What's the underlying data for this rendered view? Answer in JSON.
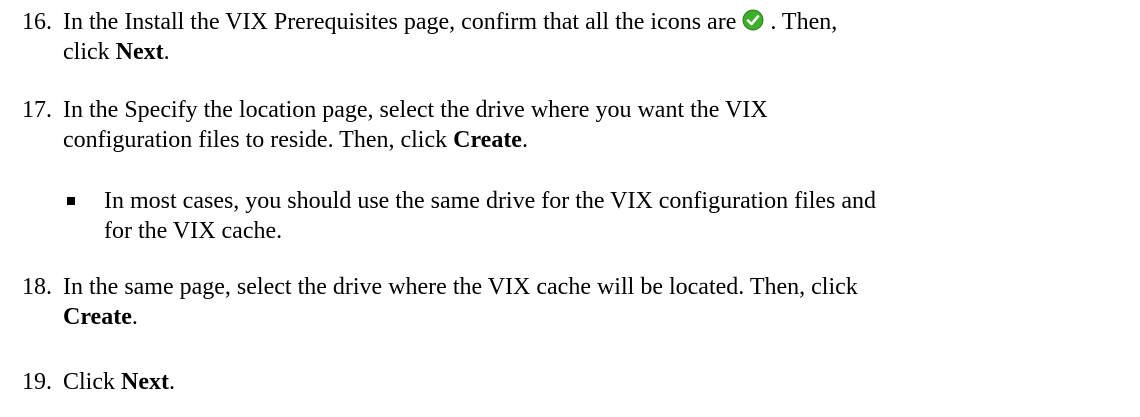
{
  "steps": [
    {
      "number": "16.",
      "lines": [
        {
          "before": "In the Install the VIX Prerequisites page, confirm that all the icons are ",
          "icon": "green-checkmark-icon",
          "after": " . Then,"
        },
        {
          "before": "click ",
          "bold": "Next",
          "after": "."
        }
      ]
    },
    {
      "number": "17.",
      "lines": [
        {
          "before": "In the Specify the location page, select the drive where you want the VIX"
        },
        {
          "before": "configuration files to reside. Then, click ",
          "bold": "Create",
          "after": "."
        }
      ]
    },
    {
      "number": "18.",
      "lines": [
        {
          "before": "In the same page, select the drive where the VIX cache will be located. Then, click"
        },
        {
          "before": "",
          "bold": "Create",
          "after": "."
        }
      ]
    },
    {
      "number": "19.",
      "lines": [
        {
          "before": "Click ",
          "bold": "Next",
          "after": "."
        }
      ]
    }
  ],
  "bullet": {
    "lines": [
      "In most cases, you should use the same drive for the VIX configuration files and",
      "for the VIX cache."
    ]
  },
  "colors": {
    "text": "#000000",
    "check_fill": "#3fae2a",
    "check_stroke": "#2b7d1c"
  }
}
